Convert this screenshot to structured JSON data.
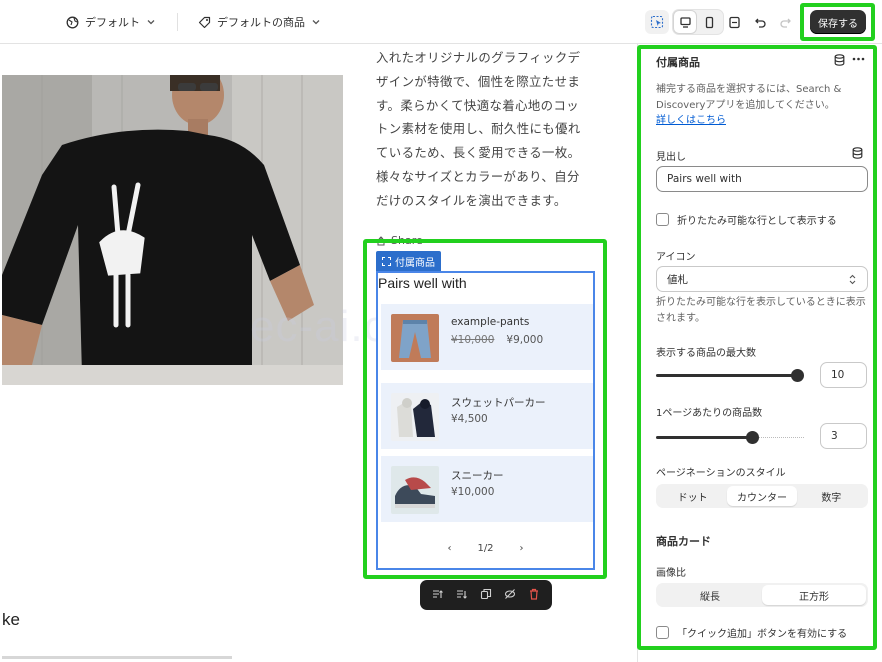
{
  "topbar": {
    "theme_label": "デフォルト",
    "template_label": "デフォルトの商品",
    "save_label": "保存する"
  },
  "canvas": {
    "description": "入れたオリジナルのグラフィックデザインが特徴で、個性を際立たせます。柔らかくて快適な着心地のコットン素材を使用し、耐久性にも優れているため、長く愛用できる一枚。様々なサイズとカラーがあり、自分だけのスタイルを演出できます。",
    "share_label": "Share",
    "block_tag": "付属商品",
    "block_title": "Pairs well with",
    "watermark": "ec-ai.com",
    "products": [
      {
        "name": "example-pants",
        "compare_price": "¥10,000",
        "price": "¥9,000"
      },
      {
        "name": "スウェットパーカー",
        "compare_price": "",
        "price": "¥4,500"
      },
      {
        "name": "スニーカー",
        "compare_price": "",
        "price": "¥10,000"
      }
    ],
    "pager": {
      "prev": "‹",
      "label": "1/2",
      "next": "›"
    },
    "bottom_text": "ke"
  },
  "panel": {
    "title": "付属商品",
    "help_text": "補完する商品を選択するには、Search & Discoveryアプリを追加してください。",
    "help_link": "詳しくはこちら",
    "heading_label": "見出し",
    "heading_value": "Pairs well with",
    "collapsible_label": "折りたたみ可能な行として表示する",
    "icon_label": "アイコン",
    "icon_value": "値札",
    "icon_help": "折りたたみ可能な行を表示しているときに表示されます。",
    "max_label": "表示する商品の最大数",
    "max_value": "10",
    "max_fraction": 1.0,
    "per_page_label": "1ページあたりの商品数",
    "per_page_value": "3",
    "per_page_fraction": 0.67,
    "pagination_label": "ページネーションのスタイル",
    "pagination_options": [
      "ドット",
      "カウンター",
      "数字"
    ],
    "pagination_selected": "カウンター",
    "card_heading": "商品カード",
    "ratio_label": "画像比",
    "ratio_options": [
      "縦長",
      "正方形"
    ],
    "ratio_selected": "正方形",
    "quick_add_label": "「クイック追加」ボタンを有効にする"
  },
  "colors": {
    "highlight": "#22d01e",
    "accent_blue": "#2c6ecb",
    "save_bg": "#303030"
  }
}
